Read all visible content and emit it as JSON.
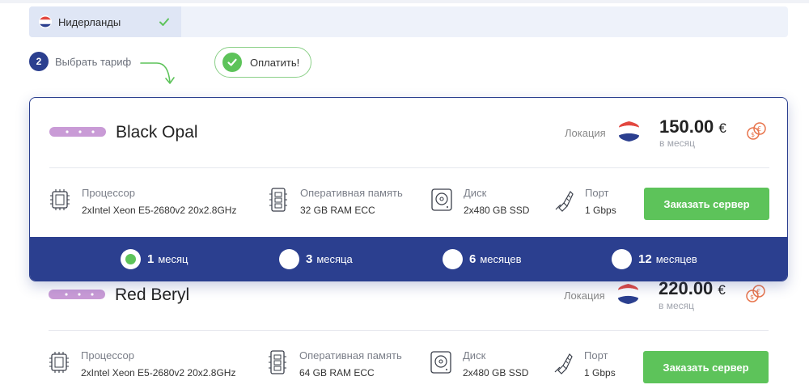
{
  "country": {
    "name": "Нидерланды"
  },
  "step": {
    "number": "2",
    "label": "Выбрать тариф"
  },
  "pay": {
    "label": "Оплатить!"
  },
  "colors": {
    "accent": "#2b3f8f",
    "green": "#5dc35a",
    "orange": "#e8744c",
    "lilac": "#c99bd6"
  },
  "plans": [
    {
      "name": "Black Opal",
      "location_label": "Локация",
      "price": "150.00",
      "currency": "€",
      "per": "в месяц",
      "specs": {
        "cpu_title": "Процессор",
        "cpu_value": "2xIntel Xeon E5-2680v2 20x2.8GHz",
        "ram_title": "Оперативная память",
        "ram_value": "32 GB RAM ECC",
        "disk_title": "Диск",
        "disk_value": "2x480 GB SSD",
        "port_title": "Порт",
        "port_value": "1 Gbps"
      },
      "order_label": "Заказать сервер"
    },
    {
      "name": "Red Beryl",
      "location_label": "Локация",
      "price": "220.00",
      "currency": "€",
      "per": "в месяц",
      "specs": {
        "cpu_title": "Процессор",
        "cpu_value": "2xIntel Xeon E5-2680v2 20x2.8GHz",
        "ram_title": "Оперативная память",
        "ram_value": "64 GB RAM ECC",
        "disk_title": "Диск",
        "disk_value": "2x480 GB SSD",
        "port_title": "Порт",
        "port_value": "1 Gbps"
      },
      "order_label": "Заказать сервер"
    }
  ],
  "terms": [
    {
      "num": "1",
      "unit": "месяц",
      "selected": true
    },
    {
      "num": "3",
      "unit": "месяца",
      "selected": false
    },
    {
      "num": "6",
      "unit": "месяцев",
      "selected": false
    },
    {
      "num": "12",
      "unit": "месяцев",
      "selected": false
    }
  ],
  "icons": {
    "flag": "netherlands-flag-icon",
    "check": "check-icon",
    "arrow": "curved-arrow-down-icon",
    "cpu": "cpu-icon",
    "ram": "ram-module-icon",
    "disk": "hard-disk-icon",
    "port": "ethernet-port-icon",
    "currency": "currency-exchange-icon",
    "server": "server-bar-icon"
  }
}
